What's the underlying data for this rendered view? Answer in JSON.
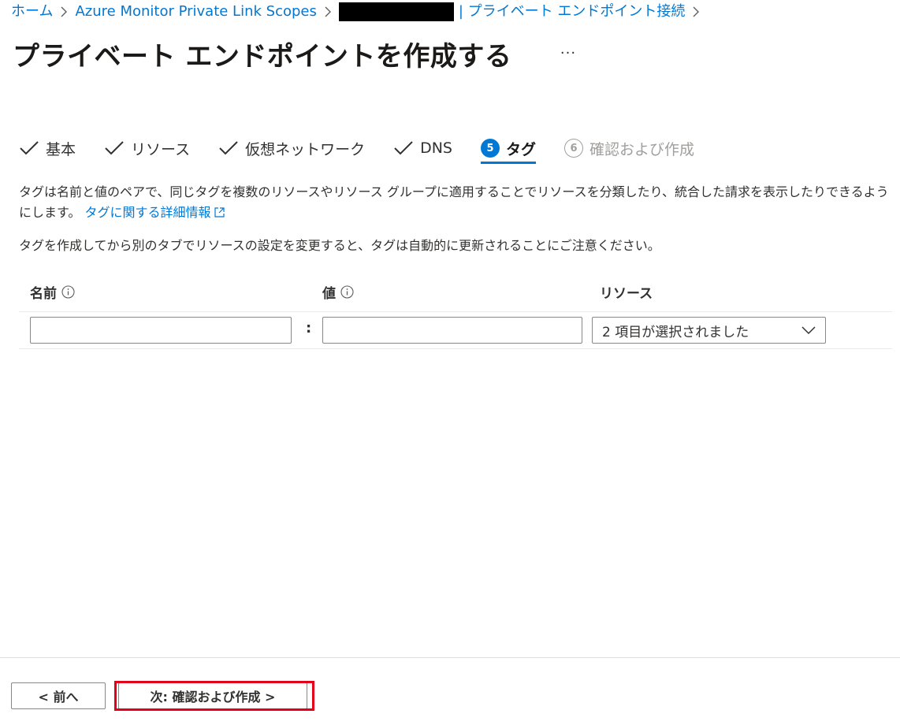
{
  "breadcrumb": {
    "items": [
      "ホーム",
      "Azure Monitor Private Link Scopes",
      "| プライベート エンドポイント接続"
    ]
  },
  "page": {
    "title": "プライベート エンドポイントを作成する",
    "more_label": "···"
  },
  "steps": [
    {
      "label": "基本",
      "state": "done"
    },
    {
      "label": "リソース",
      "state": "done"
    },
    {
      "label": "仮想ネットワーク",
      "state": "done"
    },
    {
      "label": "DNS",
      "state": "done"
    },
    {
      "number": "5",
      "label": "タグ",
      "state": "active"
    },
    {
      "number": "6",
      "label": "確認および作成",
      "state": "disabled"
    }
  ],
  "description": {
    "text": "タグは名前と値のペアで、同じタグを複数のリソースやリソース グループに適用することでリソースを分類したり、統合した請求を表示したりできるようにします。",
    "link": "タグに関する詳細情報",
    "note": "タグを作成してから別のタブでリソースの設定を変更すると、タグは自動的に更新されることにご注意ください。"
  },
  "tags_table": {
    "headers": {
      "name": "名前",
      "value": "値",
      "resource": "リソース"
    },
    "row": {
      "name_value": "",
      "value_value": "",
      "separator": ":",
      "resource_selected": "2 項目が選択されました"
    }
  },
  "footer": {
    "prev_label": "< 前へ",
    "next_label": "次: 確認および作成 >"
  },
  "colors": {
    "accent": "#0078d4",
    "highlight": "#e3001b"
  }
}
